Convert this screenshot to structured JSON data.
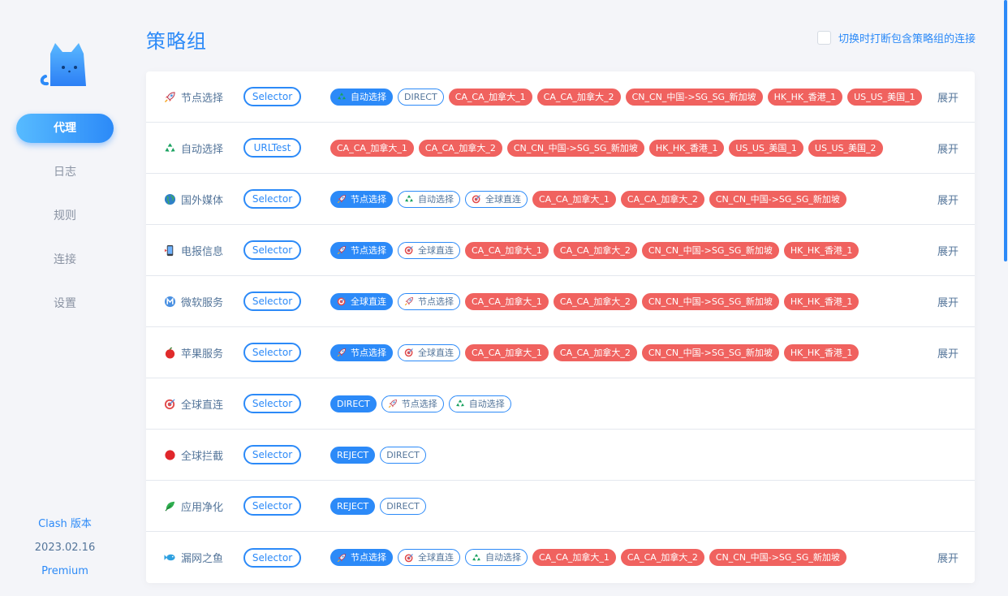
{
  "app": {
    "version_title": "Clash 版本",
    "version_date": "2023.02.16",
    "version_edition": "Premium"
  },
  "nav": [
    {
      "label": "代理",
      "active": true
    },
    {
      "label": "日志",
      "active": false
    },
    {
      "label": "规则",
      "active": false
    },
    {
      "label": "连接",
      "active": false
    },
    {
      "label": "设置",
      "active": false
    }
  ],
  "header": {
    "title": "策略组",
    "option_label": "切换时打断包含策略组的连接",
    "option_checked": false
  },
  "expand_label": "展开",
  "groups": [
    {
      "name": "节点选择",
      "icon": "rocket-icon",
      "type": "Selector",
      "expandable": true,
      "tags": [
        {
          "label": "自动选择",
          "state": "selected",
          "icon": "recycle-icon"
        },
        {
          "label": "DIRECT",
          "state": "ok"
        },
        {
          "label": "CA_CA_加拿大_1",
          "state": "fail"
        },
        {
          "label": "CA_CA_加拿大_2",
          "state": "fail"
        },
        {
          "label": "CN_CN_中国->SG_SG_新加坡",
          "state": "fail"
        },
        {
          "label": "HK_HK_香港_1",
          "state": "fail"
        },
        {
          "label": "US_US_美国_1",
          "state": "fail"
        }
      ]
    },
    {
      "name": "自动选择",
      "icon": "recycle-icon",
      "type": "URLTest",
      "expandable": true,
      "tags": [
        {
          "label": "CA_CA_加拿大_1",
          "state": "fail"
        },
        {
          "label": "CA_CA_加拿大_2",
          "state": "fail"
        },
        {
          "label": "CN_CN_中国->SG_SG_新加坡",
          "state": "fail"
        },
        {
          "label": "HK_HK_香港_1",
          "state": "fail"
        },
        {
          "label": "US_US_美国_1",
          "state": "fail"
        },
        {
          "label": "US_US_美国_2",
          "state": "fail"
        }
      ]
    },
    {
      "name": "国外媒体",
      "icon": "globe-icon",
      "type": "Selector",
      "expandable": true,
      "tags": [
        {
          "label": "节点选择",
          "state": "selected",
          "icon": "rocket-icon"
        },
        {
          "label": "自动选择",
          "state": "ok",
          "icon": "recycle-icon"
        },
        {
          "label": "全球直连",
          "state": "ok",
          "icon": "target-icon"
        },
        {
          "label": "CA_CA_加拿大_1",
          "state": "fail"
        },
        {
          "label": "CA_CA_加拿大_2",
          "state": "fail"
        },
        {
          "label": "CN_CN_中国->SG_SG_新加坡",
          "state": "fail"
        }
      ]
    },
    {
      "name": "电报信息",
      "icon": "phone-icon",
      "type": "Selector",
      "expandable": true,
      "tags": [
        {
          "label": "节点选择",
          "state": "selected",
          "icon": "rocket-icon"
        },
        {
          "label": "全球直连",
          "state": "ok",
          "icon": "target-icon"
        },
        {
          "label": "CA_CA_加拿大_1",
          "state": "fail"
        },
        {
          "label": "CA_CA_加拿大_2",
          "state": "fail"
        },
        {
          "label": "CN_CN_中国->SG_SG_新加坡",
          "state": "fail"
        },
        {
          "label": "HK_HK_香港_1",
          "state": "fail"
        }
      ]
    },
    {
      "name": "微软服务",
      "icon": "metro-m-icon",
      "type": "Selector",
      "expandable": true,
      "tags": [
        {
          "label": "全球直连",
          "state": "selected",
          "icon": "target-icon"
        },
        {
          "label": "节点选择",
          "state": "ok",
          "icon": "rocket-icon"
        },
        {
          "label": "CA_CA_加拿大_1",
          "state": "fail"
        },
        {
          "label": "CA_CA_加拿大_2",
          "state": "fail"
        },
        {
          "label": "CN_CN_中国->SG_SG_新加坡",
          "state": "fail"
        },
        {
          "label": "HK_HK_香港_1",
          "state": "fail"
        }
      ]
    },
    {
      "name": "苹果服务",
      "icon": "apple-icon",
      "type": "Selector",
      "expandable": true,
      "tags": [
        {
          "label": "节点选择",
          "state": "selected",
          "icon": "rocket-icon"
        },
        {
          "label": "全球直连",
          "state": "ok",
          "icon": "target-icon"
        },
        {
          "label": "CA_CA_加拿大_1",
          "state": "fail"
        },
        {
          "label": "CA_CA_加拿大_2",
          "state": "fail"
        },
        {
          "label": "CN_CN_中国->SG_SG_新加坡",
          "state": "fail"
        },
        {
          "label": "HK_HK_香港_1",
          "state": "fail"
        }
      ]
    },
    {
      "name": "全球直连",
      "icon": "target-icon",
      "type": "Selector",
      "expandable": false,
      "tags": [
        {
          "label": "DIRECT",
          "state": "selected"
        },
        {
          "label": "节点选择",
          "state": "ok",
          "icon": "rocket-icon"
        },
        {
          "label": "自动选择",
          "state": "ok",
          "icon": "recycle-icon"
        }
      ]
    },
    {
      "name": "全球拦截",
      "icon": "red-circle-icon",
      "type": "Selector",
      "expandable": false,
      "tags": [
        {
          "label": "REJECT",
          "state": "selected"
        },
        {
          "label": "DIRECT",
          "state": "ok"
        }
      ]
    },
    {
      "name": "应用净化",
      "icon": "leaf-icon",
      "type": "Selector",
      "expandable": false,
      "tags": [
        {
          "label": "REJECT",
          "state": "selected"
        },
        {
          "label": "DIRECT",
          "state": "ok"
        }
      ]
    },
    {
      "name": "漏网之鱼",
      "icon": "fish-icon",
      "type": "Selector",
      "expandable": true,
      "tags": [
        {
          "label": "节点选择",
          "state": "selected",
          "icon": "rocket-icon"
        },
        {
          "label": "全球直连",
          "state": "ok",
          "icon": "target-icon"
        },
        {
          "label": "自动选择",
          "state": "ok",
          "icon": "recycle-icon"
        },
        {
          "label": "CA_CA_加拿大_1",
          "state": "fail"
        },
        {
          "label": "CA_CA_加拿大_2",
          "state": "fail"
        },
        {
          "label": "CN_CN_中国->SG_SG_新加坡",
          "state": "fail"
        }
      ]
    }
  ],
  "colors": {
    "accent": "#2c8af8",
    "fail": "#f0625f",
    "text": "#54759a"
  }
}
